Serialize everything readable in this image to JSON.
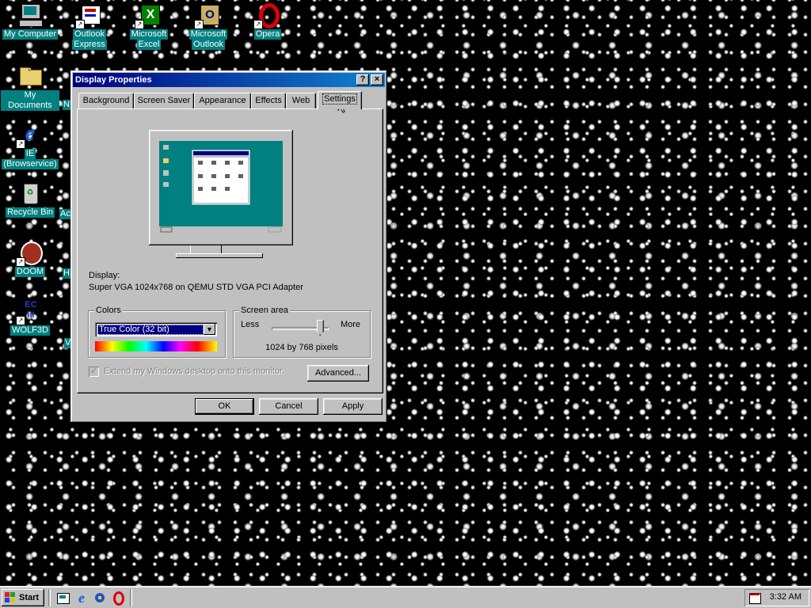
{
  "desktop": {
    "icons": [
      {
        "label_1": "My Computer",
        "label_2": ""
      },
      {
        "label_1": "Outlook",
        "label_2": "Express"
      },
      {
        "label_1": "Microsoft",
        "label_2": "Excel"
      },
      {
        "label_1": "Microsoft",
        "label_2": "Outlook"
      },
      {
        "label_1": "Opera",
        "label_2": ""
      },
      {
        "label_1": "My Documents",
        "label_2": ""
      },
      {
        "label_1": "IE",
        "label_2": "(Browservice)"
      },
      {
        "label_1": "Recycle Bin",
        "label_2": ""
      },
      {
        "label_1": "DOOM",
        "label_2": ""
      },
      {
        "label_1": "WOLF3D",
        "label_2": ""
      }
    ],
    "partial_labels": [
      "N",
      "Ac",
      "H",
      "V"
    ]
  },
  "window": {
    "title": "Display Properties",
    "help_button": "?",
    "close_button": "×",
    "tabs": [
      "Background",
      "Screen Saver",
      "Appearance",
      "Effects",
      "Web",
      "Settings"
    ],
    "active_tab": "Settings",
    "display_label": "Display:",
    "display_value": "Super VGA 1024x768 on QEMU STD VGA PCI Adapter",
    "colors_group": "Colors",
    "colors_selected": "True Color (32 bit)",
    "screen_area_group": "Screen area",
    "slider_less": "Less",
    "slider_more": "More",
    "slider_level": 0.9,
    "resolution_text": "1024 by 768 pixels",
    "extend_checkbox_label": "Extend my Windows desktop onto this monitor.",
    "advanced_button": "Advanced...",
    "ok_button": "OK",
    "cancel_button": "Cancel",
    "apply_button": "Apply"
  },
  "taskbar": {
    "start_label": "Start",
    "quick_launch": [
      "show-desktop-icon",
      "ie-icon",
      "channels-icon",
      "opera-icon"
    ],
    "clock": "3:32 AM"
  },
  "colors": {
    "title_start": "#000080",
    "title_end": "#1084d0",
    "desktop_teal": "#008080",
    "face": "#c0c0c0",
    "selection": "#000080"
  }
}
